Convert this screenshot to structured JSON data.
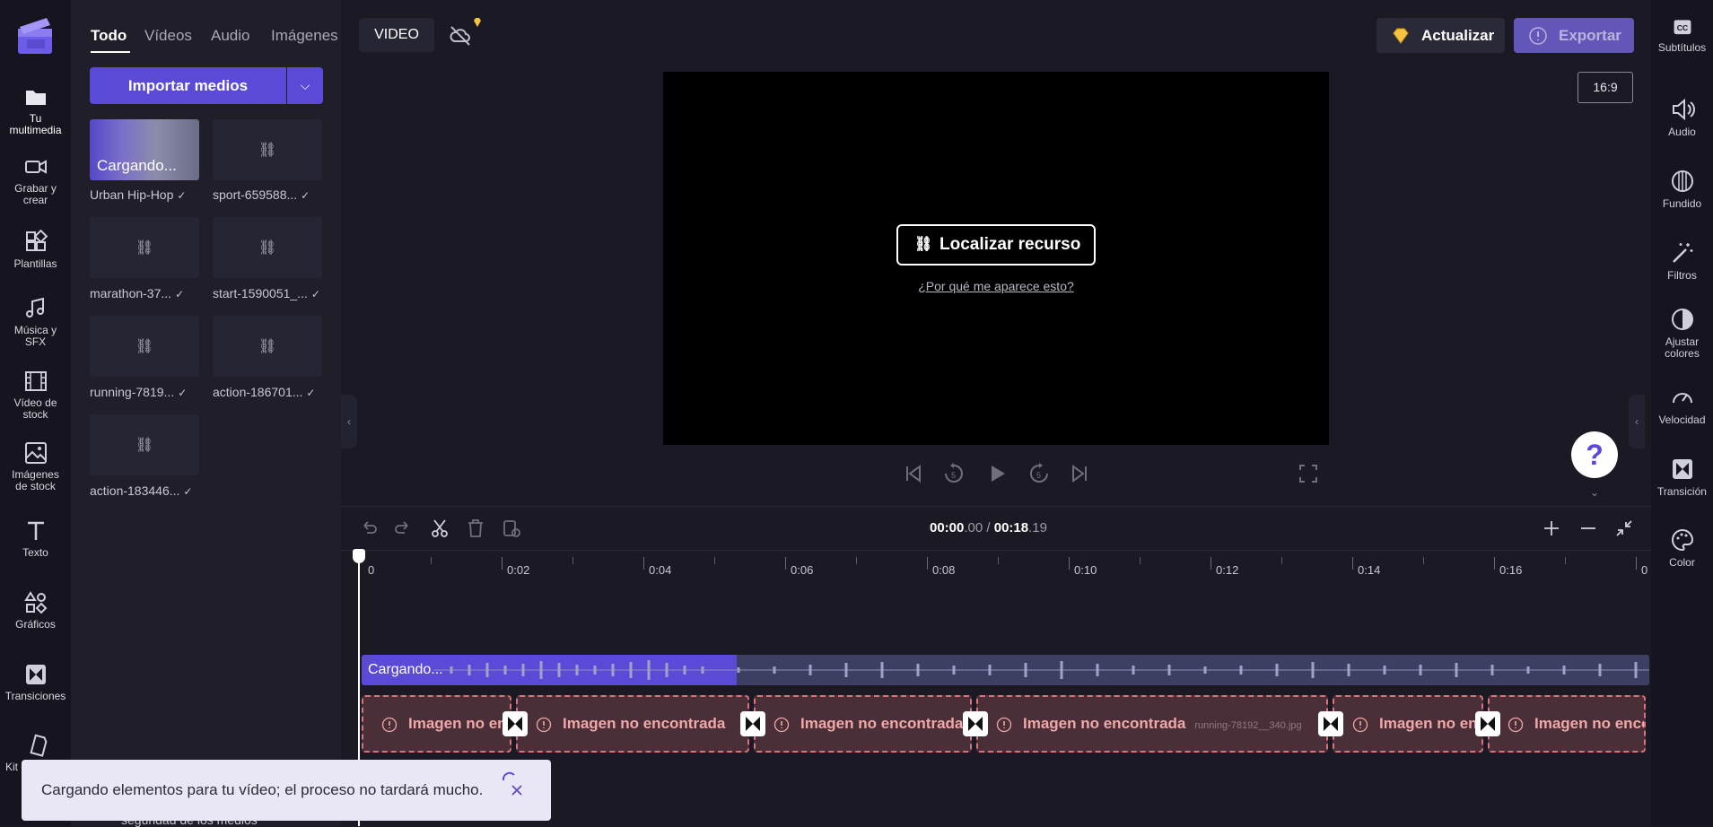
{
  "left_nav": {
    "items": [
      {
        "label_1": "Tu",
        "label_2": "multimedia"
      },
      {
        "label_1": "Grabar y",
        "label_2": "crear"
      },
      {
        "label_1": "Plantillas",
        "label_2": ""
      },
      {
        "label_1": "Música y",
        "label_2": "SFX"
      },
      {
        "label_1": "Vídeo de",
        "label_2": "stock"
      },
      {
        "label_1": "Imágenes",
        "label_2": "de stock"
      },
      {
        "label_1": "Texto",
        "label_2": ""
      },
      {
        "label_1": "Gráficos",
        "label_2": ""
      },
      {
        "label_1": "Transiciones",
        "label_2": ""
      },
      {
        "label_1": "Kit d",
        "label_2": ""
      }
    ]
  },
  "media": {
    "tabs": [
      "Todo",
      "Vídeos",
      "Audio",
      "Imágenes"
    ],
    "import_label": "Importar medios",
    "loading_label": "Cargando...",
    "items": [
      "Urban Hip-Hop",
      "sport-659588...",
      "marathon-37...",
      "start-1590051_...",
      "running-7819...",
      "action-186701...",
      "action-183446..."
    ],
    "hidden_text": "seguridad de los medios"
  },
  "topbar": {
    "video_label": "VIDEO",
    "upgrade_label": "Actualizar",
    "export_label": "Exportar",
    "ratio": "16:9"
  },
  "preview": {
    "locate_label": "Localizar recurso",
    "why_link": "¿Por qué me aparece esto?"
  },
  "timeline": {
    "time_current_main": "00:00",
    "time_current_frac": ".00",
    "time_sep": " / ",
    "time_total_main": "00:18",
    "time_total_frac": ".19",
    "ruler": [
      "0",
      "0:02",
      "0:04",
      "0:06",
      "0:08",
      "0:10",
      "0:12",
      "0:14",
      "0:16",
      "0"
    ],
    "audio_label": "Cargando...",
    "clip_label": "Imagen no encontrada",
    "clip_fname": "running-78192__340.jpg"
  },
  "right_panel": {
    "items": [
      {
        "label_1": "Subtítulos",
        "label_2": ""
      },
      {
        "label_1": "Audio",
        "label_2": ""
      },
      {
        "label_1": "Fundido",
        "label_2": ""
      },
      {
        "label_1": "Filtros",
        "label_2": ""
      },
      {
        "label_1": "Ajustar",
        "label_2": "colores"
      },
      {
        "label_1": "Velocidad",
        "label_2": ""
      },
      {
        "label_1": "Transición",
        "label_2": ""
      },
      {
        "label_1": "Color",
        "label_2": ""
      }
    ]
  },
  "toast": {
    "message": "Cargando elementos para tu vídeo; el proceso no tardará mucho."
  },
  "colors": {
    "accent": "#5b4ad8",
    "error": "#d8747a",
    "premium": "#f5c242"
  }
}
